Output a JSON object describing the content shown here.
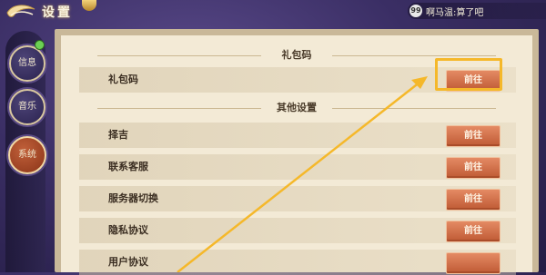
{
  "header": {
    "title": "设置",
    "chat_level": "99",
    "chat_message": "啊马温:算了吧"
  },
  "sidebar": {
    "tabs": [
      {
        "label": "信息"
      },
      {
        "label": "音乐"
      },
      {
        "label": "系统"
      }
    ]
  },
  "sections": {
    "gift": "礼包码",
    "other": "其他设置"
  },
  "rows": [
    {
      "label": "礼包码",
      "button": "前往"
    },
    {
      "label": "择吉",
      "button": "前往"
    },
    {
      "label": "联系客服",
      "button": "前往"
    },
    {
      "label": "服务器切换",
      "button": "前往"
    },
    {
      "label": "隐私协议",
      "button": "前往"
    },
    {
      "label": "用户协议",
      "button": ""
    }
  ],
  "colors": {
    "accent_button": "#d06e48",
    "highlight": "#f5b82a",
    "arrow": "#f5b82a"
  }
}
